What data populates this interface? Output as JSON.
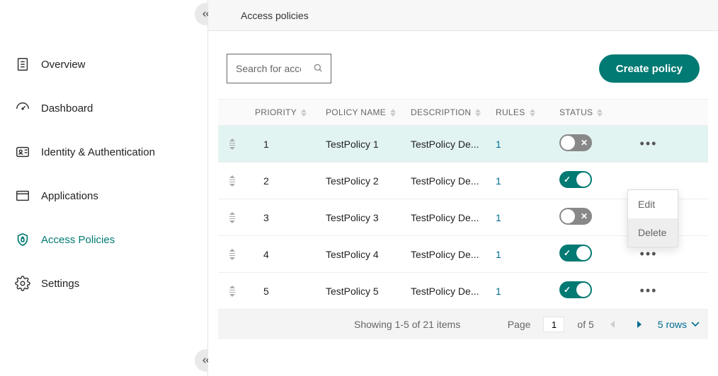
{
  "header": {
    "title": "Access policies"
  },
  "sidebar": {
    "items": [
      {
        "label": "Overview"
      },
      {
        "label": "Dashboard"
      },
      {
        "label": "Identity & Authentication"
      },
      {
        "label": "Applications"
      },
      {
        "label": "Access Policies"
      },
      {
        "label": "Settings"
      }
    ]
  },
  "toolbar": {
    "search_placeholder": "Search for access",
    "create_label": "Create policy"
  },
  "table": {
    "headers": {
      "priority": "PRIORITY",
      "policy": "POLICY NAME",
      "description": "DESCRIPTION",
      "rules": "RULES",
      "status": "STATUS"
    },
    "rows": [
      {
        "priority": "1",
        "name": "TestPolicy 1",
        "desc": "TestPolicy De...",
        "rules": "1",
        "status": "off"
      },
      {
        "priority": "2",
        "name": "TestPolicy 2",
        "desc": "TestPolicy De...",
        "rules": "1",
        "status": "on"
      },
      {
        "priority": "3",
        "name": "TestPolicy 3",
        "desc": "TestPolicy De...",
        "rules": "1",
        "status": "off"
      },
      {
        "priority": "4",
        "name": "TestPolicy 4",
        "desc": "TestPolicy De...",
        "rules": "1",
        "status": "on"
      },
      {
        "priority": "5",
        "name": "TestPolicy 5",
        "desc": "TestPolicy De...",
        "rules": "1",
        "status": "on"
      }
    ]
  },
  "dropdown": {
    "edit": "Edit",
    "delete": "Delete"
  },
  "pagination": {
    "showing": "Showing 1-5 of 21 items",
    "page_label_pre": "Page",
    "current_page": "1",
    "page_label_post": "of 5",
    "rows_label": "5 rows"
  }
}
